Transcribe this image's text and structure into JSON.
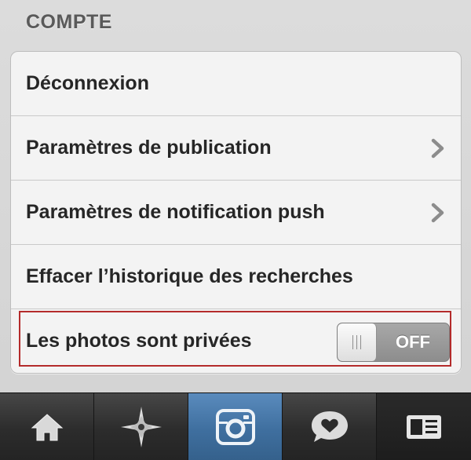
{
  "section": {
    "title": "COMPTE"
  },
  "rows": [
    {
      "label": "Déconnexion",
      "has_chevron": false
    },
    {
      "label": "Paramètres de publication",
      "has_chevron": true
    },
    {
      "label": "Paramètres de notification push",
      "has_chevron": true
    },
    {
      "label": "Effacer l’historique des recherches",
      "has_chevron": false
    },
    {
      "label": "Les photos sont privées",
      "has_chevron": false
    }
  ],
  "private_toggle": {
    "state_label": "OFF",
    "on": false
  },
  "tabbar": {
    "items": [
      {
        "icon": "home-icon",
        "active": false
      },
      {
        "icon": "explore-compass-icon",
        "active": false
      },
      {
        "icon": "camera-icon",
        "active": true
      },
      {
        "icon": "activity-heart-bubble-icon",
        "active": false
      },
      {
        "icon": "profile-card-icon",
        "active": false,
        "selected_dark": true
      }
    ]
  },
  "colors": {
    "accent_tab": "#4a7aab",
    "highlight_border": "#b42b2b",
    "toggle_off": "#9a9a9a"
  }
}
